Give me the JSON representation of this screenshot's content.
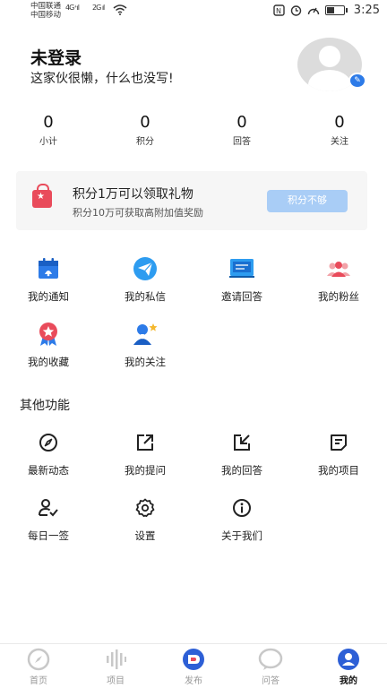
{
  "status_bar": {
    "carrier_1": "中国联通",
    "carrier_2": "中国移动",
    "net_1": "4G⁺ıl",
    "net_2": "2G ıl",
    "time": "3:25",
    "icons": [
      "wifi-icon",
      "nfc-icon",
      "alarm-icon",
      "speed-icon",
      "battery-icon"
    ]
  },
  "profile": {
    "name": "未登录",
    "bio": "这家伙很懒，什么也没写!"
  },
  "stats": [
    {
      "value": "0",
      "label": "小计"
    },
    {
      "value": "0",
      "label": "积分"
    },
    {
      "value": "0",
      "label": "回答"
    },
    {
      "value": "0",
      "label": "关注"
    }
  ],
  "gift": {
    "title": "积分1万可以领取礼物",
    "subtitle": "积分10万可获取高附加值奖励",
    "button": "积分不够"
  },
  "main_menu": [
    {
      "label": "我的通知",
      "icon": "calendar-notice-icon"
    },
    {
      "label": "我的私信",
      "icon": "message-icon"
    },
    {
      "label": "邀请回答",
      "icon": "book-invite-icon"
    },
    {
      "label": "我的粉丝",
      "icon": "fans-icon"
    },
    {
      "label": "我的收藏",
      "icon": "favorite-badge-icon"
    },
    {
      "label": "我的关注",
      "icon": "follow-star-icon"
    }
  ],
  "other_section_title": "其他功能",
  "other_menu": [
    {
      "label": "最新动态",
      "icon": "compass-icon"
    },
    {
      "label": "我的提问",
      "icon": "share-out-icon"
    },
    {
      "label": "我的回答",
      "icon": "reply-in-icon"
    },
    {
      "label": "我的项目",
      "icon": "document-icon"
    },
    {
      "label": "每日一签",
      "icon": "user-check-icon"
    },
    {
      "label": "设置",
      "icon": "gear-icon"
    },
    {
      "label": "关于我们",
      "icon": "info-icon"
    }
  ],
  "bottom_nav": [
    {
      "label": "首页",
      "icon": "compass-icon",
      "active": false
    },
    {
      "label": "项目",
      "icon": "waveform-icon",
      "active": false
    },
    {
      "label": "发布",
      "icon": "publish-icon",
      "active": false
    },
    {
      "label": "问答",
      "icon": "chat-bubble-icon",
      "active": false
    },
    {
      "label": "我的",
      "icon": "user-circle-icon",
      "active": true
    }
  ],
  "colors": {
    "accent": "#2d7be8",
    "gift_bag": "#e94b5b",
    "gift_button": "#a9cdf6",
    "card_bg": "#f6f6f6"
  }
}
